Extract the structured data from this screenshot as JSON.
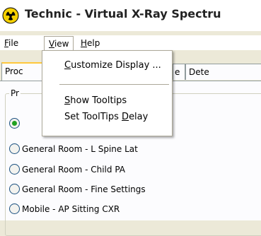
{
  "window": {
    "title": "Technic - Virtual X-Ray Spectru",
    "icon": "radiation-icon"
  },
  "menubar": {
    "file": {
      "mnemonic": "F",
      "rest": "ile"
    },
    "view": {
      "mnemonic": "V",
      "rest": "iew"
    },
    "help": {
      "mnemonic": "H",
      "rest": "elp"
    }
  },
  "view_menu": {
    "items": [
      {
        "mnemonic": "C",
        "rest": "ustomize Display ..."
      },
      {
        "mnemonic": "S",
        "rest": "how Tooltips"
      },
      {
        "before": "Set ToolTips ",
        "mnemonic": "D",
        "rest": "elay"
      }
    ]
  },
  "tabs": [
    {
      "label": "Proc"
    },
    {
      "label": "e"
    },
    {
      "label": "Dete"
    }
  ],
  "group": {
    "label": "Pr"
  },
  "presets": [
    {
      "label": "",
      "checked": true
    },
    {
      "label": "General Room - L Spine Lat",
      "checked": false
    },
    {
      "label": "General Room - Child PA",
      "checked": false
    },
    {
      "label": "General Room - Fine Settings",
      "checked": false
    },
    {
      "label": "Mobile - AP Sitting CXR",
      "checked": false
    }
  ],
  "colors": {
    "active_tab_accent": "#ffc83c",
    "radio_checked": "#21a121"
  }
}
